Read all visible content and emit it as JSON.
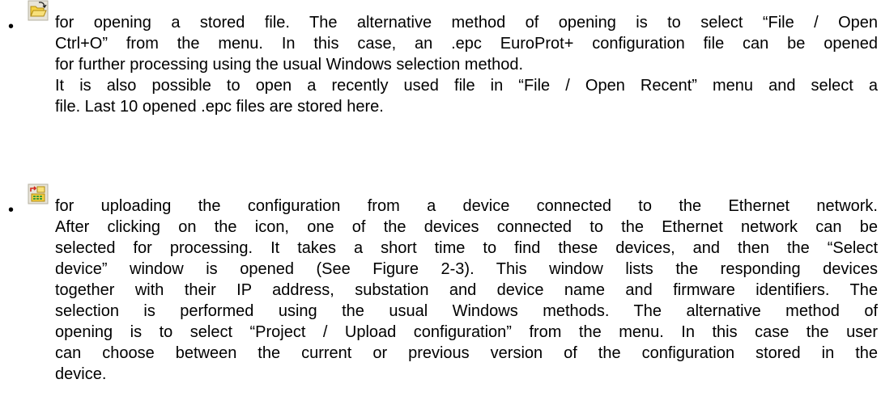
{
  "items": [
    {
      "icon": "open-folder-icon",
      "lines": [
        "for opening a stored file. The alternative method of opening is to select “File / Open",
        "Ctrl+O” from the menu.  In this case, an .epc EuroProt+ configuration file can be opened",
        "for further processing using the usual Windows selection method.",
        "It is also possible to open a recently used file in “File / Open Recent” menu and select a",
        "file. Last 10 opened .epc files are stored here."
      ]
    },
    {
      "icon": "upload-configuration-icon",
      "lines": [
        "for uploading the configuration from a device connected to the Ethernet network.",
        "After clicking on the icon, one of the devices connected to the Ethernet network can be",
        "selected for processing. It takes a short time to find these devices, and then the “Select",
        "device” window is opened (See Figure 2-3). This window lists the responding devices",
        "together with their IP address, substation and device name and firmware identifiers. The",
        "selection is performed using the usual Windows methods. The alternative method of",
        "opening is to select “Project / Upload configuration” from the menu. In this case the user",
        "can choose between the current or previous version of the configuration stored in the",
        "device."
      ]
    }
  ],
  "bullet_char": "•",
  "colors": {
    "text": "#000000",
    "folder_yellow": "#f5d142",
    "folder_dark": "#b08a12",
    "arrow_red": "#d22a1e",
    "device_green": "#3c9a3c"
  }
}
